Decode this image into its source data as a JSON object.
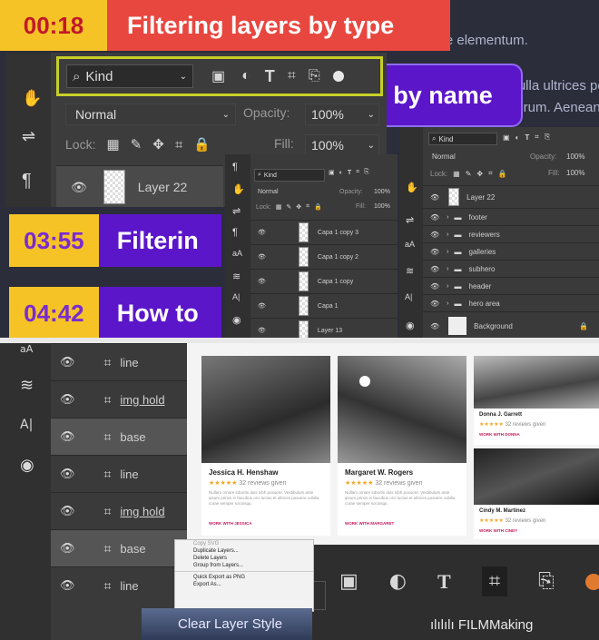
{
  "top_background_text": [
    "n vitae elementum.",
    "Nulla ultrices pos",
    "uorum. Aenean im"
  ],
  "banners": [
    {
      "time": "00:18",
      "label": "Filtering layers by type"
    },
    {
      "time": "03:55",
      "label": "Filterin"
    },
    {
      "time": "04:42",
      "label": "How to"
    }
  ],
  "name_badge": "by name",
  "main_panel": {
    "filter_kind": "Kind",
    "blend_mode": "Normal",
    "opacity_label": "Opacity:",
    "opacity_value": "100%",
    "lock_label": "Lock:",
    "fill_label": "Fill:",
    "fill_value": "100%",
    "layer_name": "Layer 22"
  },
  "small_panel_a": {
    "filter_kind": "Kind",
    "blend_mode": "Normal",
    "opacity_label": "Opacity:",
    "opacity_value": "100%",
    "lock_label": "Lock:",
    "fill_label": "Fill:",
    "fill_value": "100%",
    "layers": [
      "Capa 1 copy 3",
      "Capa 1 copy 2",
      "Capa 1 copy",
      "Capa 1",
      "Layer 13"
    ]
  },
  "small_panel_b": {
    "filter_kind": "Kind",
    "blend_mode": "Normal",
    "opacity_label": "Opacity:",
    "opacity_value": "100%",
    "lock_label": "Lock:",
    "fill_label": "Fill:",
    "fill_value": "100%",
    "layers": [
      "Layer 22",
      "footer",
      "reviewers",
      "galleries",
      "subhero",
      "header",
      "hero area",
      "Background"
    ]
  },
  "bottom_layers": [
    "line",
    "img hold",
    "base",
    "line",
    "img hold",
    "base",
    "line"
  ],
  "cards": [
    {
      "name": "Jessica H. Henshaw",
      "reviews": "32 reviews given",
      "desc": "Nullam ornare lobortis duis nibh posuere. Vestibulum ante ipsum primis in faucibus orci luctus et ultrices posuere cubilia curae semper sociosqu.",
      "cta": "WORK WITH JESSICA"
    },
    {
      "name": "Margaret W. Rogers",
      "reviews": "32 reviews given",
      "desc": "Nullam ornare lobortis duis nibh posuere. Vestibulum ante ipsum primis in faucibus orci luctus et ultrices posuere cubilia curae semper sociosqu.",
      "cta": "WORK WITH MARGARET"
    },
    {
      "name": "Donna J. Garrett",
      "reviews": "32 reviews given",
      "cta": "WORK WITH DONNA"
    },
    {
      "name": "Cindy M. Martinez",
      "reviews": "32 reviews given",
      "cta": "WORK WITH CINDY"
    }
  ],
  "context_menu": [
    "Copy SVG",
    "Duplicate Layers...",
    "Delete Layers",
    "Group from Layers...",
    "Quick Export as PNG",
    "Export As..."
  ],
  "bottom_label": "Clear Layer Style",
  "watermark": "ılılılı FILMMaking",
  "colors": {
    "yellow": "#f5c326",
    "red": "#e8473f",
    "purple": "#5b16c9",
    "highlight": "#c7cf27"
  }
}
